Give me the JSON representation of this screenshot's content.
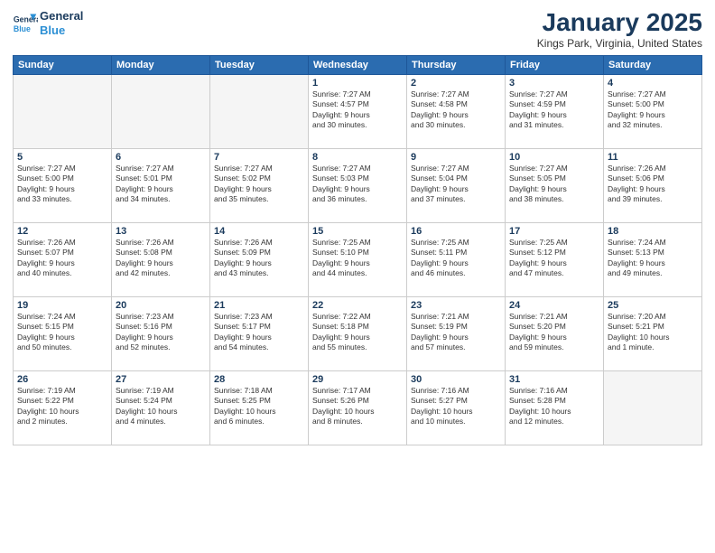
{
  "header": {
    "logo_line1": "General",
    "logo_line2": "Blue",
    "month": "January 2025",
    "location": "Kings Park, Virginia, United States"
  },
  "weekdays": [
    "Sunday",
    "Monday",
    "Tuesday",
    "Wednesday",
    "Thursday",
    "Friday",
    "Saturday"
  ],
  "weeks": [
    [
      {
        "day": "",
        "text": ""
      },
      {
        "day": "",
        "text": ""
      },
      {
        "day": "",
        "text": ""
      },
      {
        "day": "1",
        "text": "Sunrise: 7:27 AM\nSunset: 4:57 PM\nDaylight: 9 hours\nand 30 minutes."
      },
      {
        "day": "2",
        "text": "Sunrise: 7:27 AM\nSunset: 4:58 PM\nDaylight: 9 hours\nand 30 minutes."
      },
      {
        "day": "3",
        "text": "Sunrise: 7:27 AM\nSunset: 4:59 PM\nDaylight: 9 hours\nand 31 minutes."
      },
      {
        "day": "4",
        "text": "Sunrise: 7:27 AM\nSunset: 5:00 PM\nDaylight: 9 hours\nand 32 minutes."
      }
    ],
    [
      {
        "day": "5",
        "text": "Sunrise: 7:27 AM\nSunset: 5:00 PM\nDaylight: 9 hours\nand 33 minutes."
      },
      {
        "day": "6",
        "text": "Sunrise: 7:27 AM\nSunset: 5:01 PM\nDaylight: 9 hours\nand 34 minutes."
      },
      {
        "day": "7",
        "text": "Sunrise: 7:27 AM\nSunset: 5:02 PM\nDaylight: 9 hours\nand 35 minutes."
      },
      {
        "day": "8",
        "text": "Sunrise: 7:27 AM\nSunset: 5:03 PM\nDaylight: 9 hours\nand 36 minutes."
      },
      {
        "day": "9",
        "text": "Sunrise: 7:27 AM\nSunset: 5:04 PM\nDaylight: 9 hours\nand 37 minutes."
      },
      {
        "day": "10",
        "text": "Sunrise: 7:27 AM\nSunset: 5:05 PM\nDaylight: 9 hours\nand 38 minutes."
      },
      {
        "day": "11",
        "text": "Sunrise: 7:26 AM\nSunset: 5:06 PM\nDaylight: 9 hours\nand 39 minutes."
      }
    ],
    [
      {
        "day": "12",
        "text": "Sunrise: 7:26 AM\nSunset: 5:07 PM\nDaylight: 9 hours\nand 40 minutes."
      },
      {
        "day": "13",
        "text": "Sunrise: 7:26 AM\nSunset: 5:08 PM\nDaylight: 9 hours\nand 42 minutes."
      },
      {
        "day": "14",
        "text": "Sunrise: 7:26 AM\nSunset: 5:09 PM\nDaylight: 9 hours\nand 43 minutes."
      },
      {
        "day": "15",
        "text": "Sunrise: 7:25 AM\nSunset: 5:10 PM\nDaylight: 9 hours\nand 44 minutes."
      },
      {
        "day": "16",
        "text": "Sunrise: 7:25 AM\nSunset: 5:11 PM\nDaylight: 9 hours\nand 46 minutes."
      },
      {
        "day": "17",
        "text": "Sunrise: 7:25 AM\nSunset: 5:12 PM\nDaylight: 9 hours\nand 47 minutes."
      },
      {
        "day": "18",
        "text": "Sunrise: 7:24 AM\nSunset: 5:13 PM\nDaylight: 9 hours\nand 49 minutes."
      }
    ],
    [
      {
        "day": "19",
        "text": "Sunrise: 7:24 AM\nSunset: 5:15 PM\nDaylight: 9 hours\nand 50 minutes."
      },
      {
        "day": "20",
        "text": "Sunrise: 7:23 AM\nSunset: 5:16 PM\nDaylight: 9 hours\nand 52 minutes."
      },
      {
        "day": "21",
        "text": "Sunrise: 7:23 AM\nSunset: 5:17 PM\nDaylight: 9 hours\nand 54 minutes."
      },
      {
        "day": "22",
        "text": "Sunrise: 7:22 AM\nSunset: 5:18 PM\nDaylight: 9 hours\nand 55 minutes."
      },
      {
        "day": "23",
        "text": "Sunrise: 7:21 AM\nSunset: 5:19 PM\nDaylight: 9 hours\nand 57 minutes."
      },
      {
        "day": "24",
        "text": "Sunrise: 7:21 AM\nSunset: 5:20 PM\nDaylight: 9 hours\nand 59 minutes."
      },
      {
        "day": "25",
        "text": "Sunrise: 7:20 AM\nSunset: 5:21 PM\nDaylight: 10 hours\nand 1 minute."
      }
    ],
    [
      {
        "day": "26",
        "text": "Sunrise: 7:19 AM\nSunset: 5:22 PM\nDaylight: 10 hours\nand 2 minutes."
      },
      {
        "day": "27",
        "text": "Sunrise: 7:19 AM\nSunset: 5:24 PM\nDaylight: 10 hours\nand 4 minutes."
      },
      {
        "day": "28",
        "text": "Sunrise: 7:18 AM\nSunset: 5:25 PM\nDaylight: 10 hours\nand 6 minutes."
      },
      {
        "day": "29",
        "text": "Sunrise: 7:17 AM\nSunset: 5:26 PM\nDaylight: 10 hours\nand 8 minutes."
      },
      {
        "day": "30",
        "text": "Sunrise: 7:16 AM\nSunset: 5:27 PM\nDaylight: 10 hours\nand 10 minutes."
      },
      {
        "day": "31",
        "text": "Sunrise: 7:16 AM\nSunset: 5:28 PM\nDaylight: 10 hours\nand 12 minutes."
      },
      {
        "day": "",
        "text": ""
      }
    ]
  ]
}
